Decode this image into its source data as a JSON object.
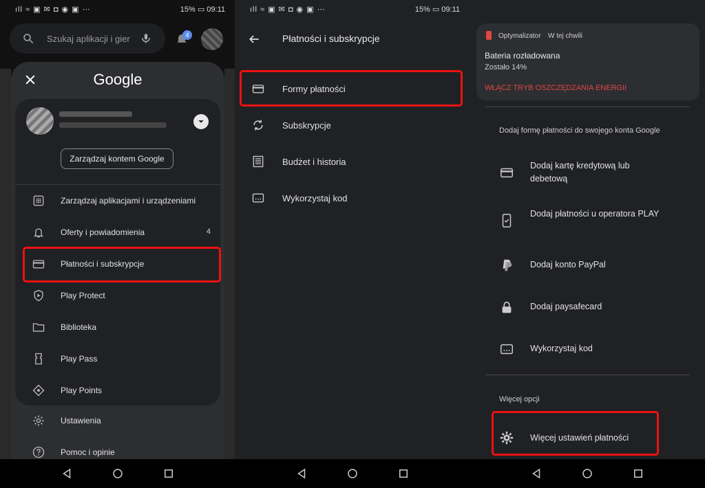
{
  "status_bar": {
    "left": "ıll ≈ ▣ ✉ ◘ ◉ ▣ ⋯",
    "battery": "15%",
    "time": "09:11"
  },
  "panel1": {
    "search_placeholder": "Szukaj aplikacji i gier",
    "notification_count": "4",
    "drawer": {
      "logo": "Google",
      "manage_account": "Zarządzaj kontem Google",
      "items": [
        {
          "label": "Zarządzaj aplikacjami i urządzeniami",
          "icon": "grid-icon"
        },
        {
          "label": "Oferty i powiadomienia",
          "icon": "bell-icon",
          "count": "4"
        },
        {
          "label": "Płatności i subskrypcje",
          "icon": "card-icon"
        },
        {
          "label": "Play Protect",
          "icon": "shield-icon"
        },
        {
          "label": "Biblioteka",
          "icon": "folder-icon"
        },
        {
          "label": "Play Pass",
          "icon": "ticket-icon"
        },
        {
          "label": "Play Points",
          "icon": "diamond-icon"
        }
      ],
      "bottom_items": [
        {
          "label": "Ustawienia",
          "icon": "gear-icon"
        },
        {
          "label": "Pomoc i opinie",
          "icon": "help-icon"
        }
      ]
    }
  },
  "panel2": {
    "title": "Płatności i subskrypcje",
    "items": [
      {
        "label": "Formy płatności",
        "icon": "card-icon"
      },
      {
        "label": "Subskrypcje",
        "icon": "sync-icon"
      },
      {
        "label": "Budżet i historia",
        "icon": "receipt-icon"
      },
      {
        "label": "Wykorzystaj kod",
        "icon": "code-card-icon"
      }
    ]
  },
  "panel3": {
    "notification": {
      "app": "Optymalizator",
      "time": "W tej chwili",
      "title": "Bateria rozładowana",
      "subtitle": "Zostało 14%",
      "action": "WŁĄCZ TRYB OSZCZĘDZANIA ENERGII"
    },
    "add_heading": "Dodaj formę płatności do swojego konta Google",
    "items": [
      {
        "label": "Dodaj kartę kredytową lub debetową",
        "icon": "card-icon"
      },
      {
        "label": "Dodaj płatności u operatora PLAY",
        "icon": "phone-icon"
      },
      {
        "label": "Dodaj konto PayPal",
        "icon": "paypal-icon"
      },
      {
        "label": "Dodaj paysafecard",
        "icon": "lock-icon"
      },
      {
        "label": "Wykorzystaj kod",
        "icon": "code-card-icon"
      }
    ],
    "more_heading": "Więcej opcji",
    "more_item": {
      "label": "Więcej ustawień płatności",
      "icon": "gear-icon"
    }
  },
  "colors": {
    "highlight": "#ee1111",
    "warning": "#e04646",
    "background": "#202124"
  }
}
